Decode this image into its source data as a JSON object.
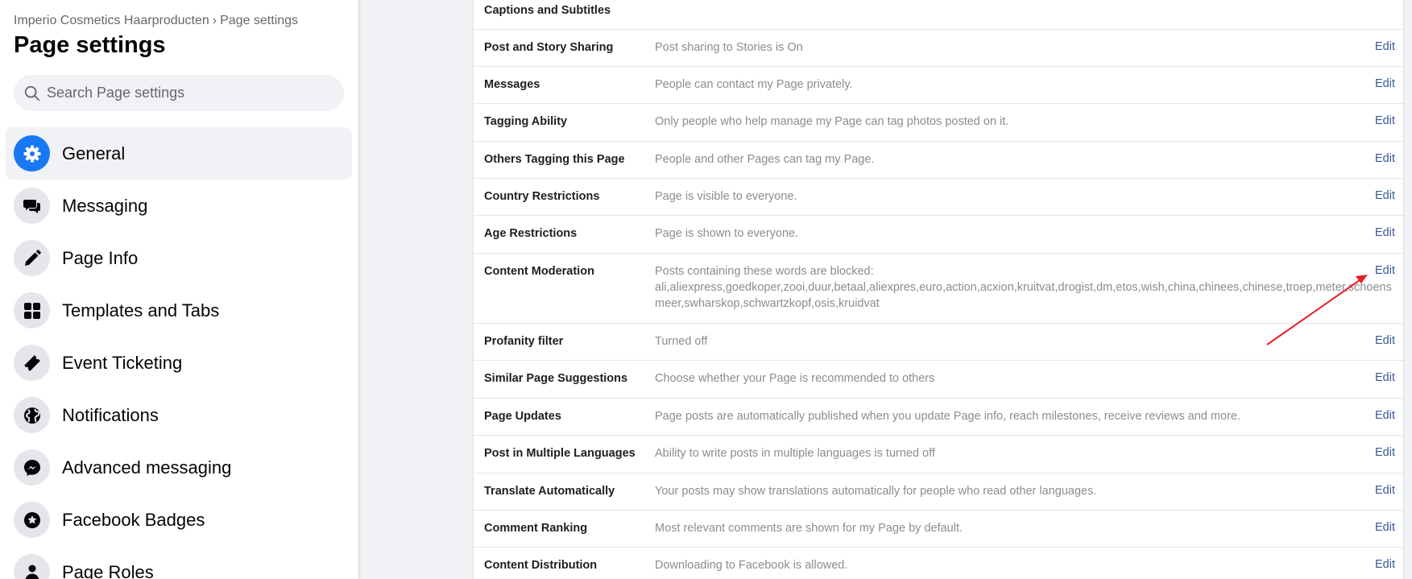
{
  "breadcrumb": {
    "page_name": "Imperio Cosmetics Haarproducten",
    "separator": "›",
    "current": "Page settings"
  },
  "page_title": "Page settings",
  "search": {
    "placeholder": "Search Page settings",
    "value": ""
  },
  "nav": {
    "items": [
      {
        "label": "General",
        "icon": "gear-icon",
        "active": true
      },
      {
        "label": "Messaging",
        "icon": "chat-bubbles-icon"
      },
      {
        "label": "Page Info",
        "icon": "pencil-icon"
      },
      {
        "label": "Templates and Tabs",
        "icon": "grid-icon"
      },
      {
        "label": "Event Ticketing",
        "icon": "ticket-icon"
      },
      {
        "label": "Notifications",
        "icon": "globe-icon"
      },
      {
        "label": "Advanced messaging",
        "icon": "messenger-icon"
      },
      {
        "label": "Facebook Badges",
        "icon": "star-badge-icon"
      },
      {
        "label": "Page Roles",
        "icon": "person-icon"
      }
    ]
  },
  "settings": {
    "edit_label": "Edit",
    "rows": [
      {
        "label": "Captions and Subtitles",
        "value": []
      },
      {
        "label": "Post and Story Sharing",
        "value": [
          "Post sharing to Stories is On"
        ]
      },
      {
        "label": "Messages",
        "value": [
          "People can contact my Page privately."
        ]
      },
      {
        "label": "Tagging Ability",
        "value": [
          "Only people who help manage my Page can tag photos posted on it."
        ]
      },
      {
        "label": "Others Tagging this Page",
        "value": [
          "People and other Pages can tag my Page."
        ]
      },
      {
        "label": "Country Restrictions",
        "value": [
          "Page is visible to everyone."
        ]
      },
      {
        "label": "Age Restrictions",
        "value": [
          "Page is shown to everyone."
        ]
      },
      {
        "label": "Content Moderation",
        "value": [
          "Posts containing these words are blocked:",
          "ali,aliexpress,goedkoper,zooi,duur,betaal,aliexpres,euro,action,acxion,kruitvat,drogist,dm,etos,wish,china,chinees,chinese,troep,meter,schoensmeer,swharskop,schwartzkopf,osis,kruidvat"
        ]
      },
      {
        "label": "Profanity filter",
        "value": [
          "Turned off"
        ]
      },
      {
        "label": "Similar Page Suggestions",
        "value": [
          "Choose whether your Page is recommended to others"
        ]
      },
      {
        "label": "Page Updates",
        "value": [
          "Page posts are automatically published when you update Page info, reach milestones, receive reviews and more."
        ]
      },
      {
        "label": "Post in Multiple Languages",
        "value": [
          "Ability to write posts in multiple languages is turned off"
        ]
      },
      {
        "label": "Translate Automatically",
        "value": [
          "Your posts may show translations automatically for people who read other languages."
        ]
      },
      {
        "label": "Comment Ranking",
        "value": [
          "Most relevant comments are shown for my Page by default."
        ]
      },
      {
        "label": "Content Distribution",
        "value": [
          "Downloading to Facebook is allowed."
        ]
      }
    ]
  },
  "colors": {
    "accent": "#1877f2",
    "link": "#385898",
    "annotation_arrow": "#e41e26"
  }
}
